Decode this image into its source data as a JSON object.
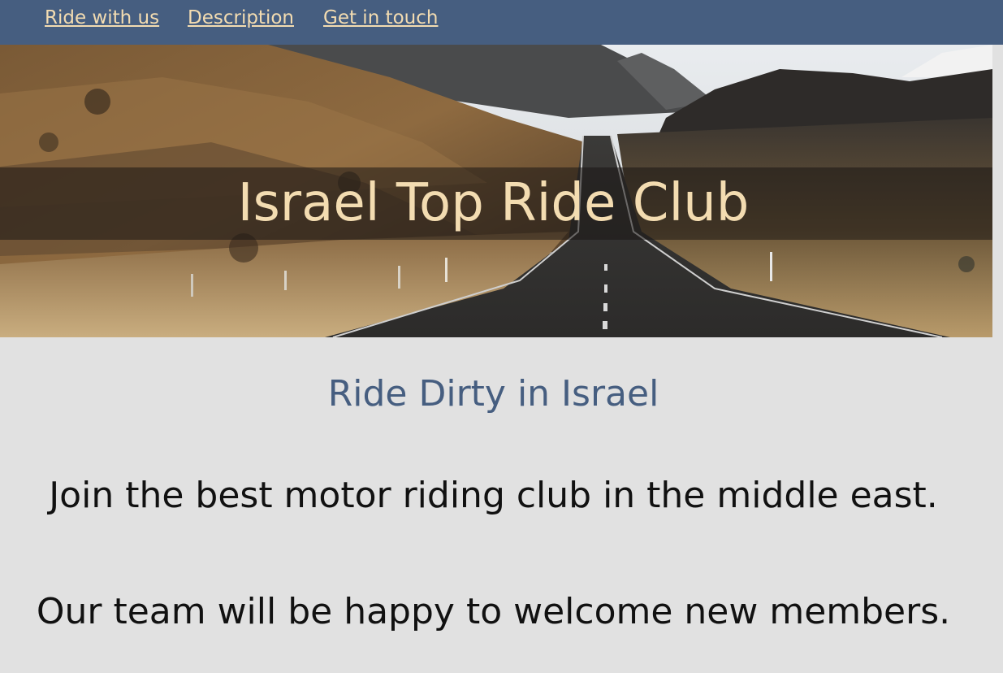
{
  "nav": {
    "items": [
      {
        "label": "Ride with us"
      },
      {
        "label": "Description"
      },
      {
        "label": "Get in touch"
      }
    ]
  },
  "hero": {
    "title": "Israel Top Ride Club"
  },
  "main": {
    "subtitle": "Ride Dirty in Israel",
    "paragraphs": [
      "Join the best motor riding club in the middle east.",
      "Our team will be happy to welcome new members."
    ]
  },
  "colors": {
    "nav_bg": "#465e80",
    "accent_text": "#f3dcb1",
    "page_bg": "#e1e1e1",
    "subtitle": "#465e80"
  }
}
